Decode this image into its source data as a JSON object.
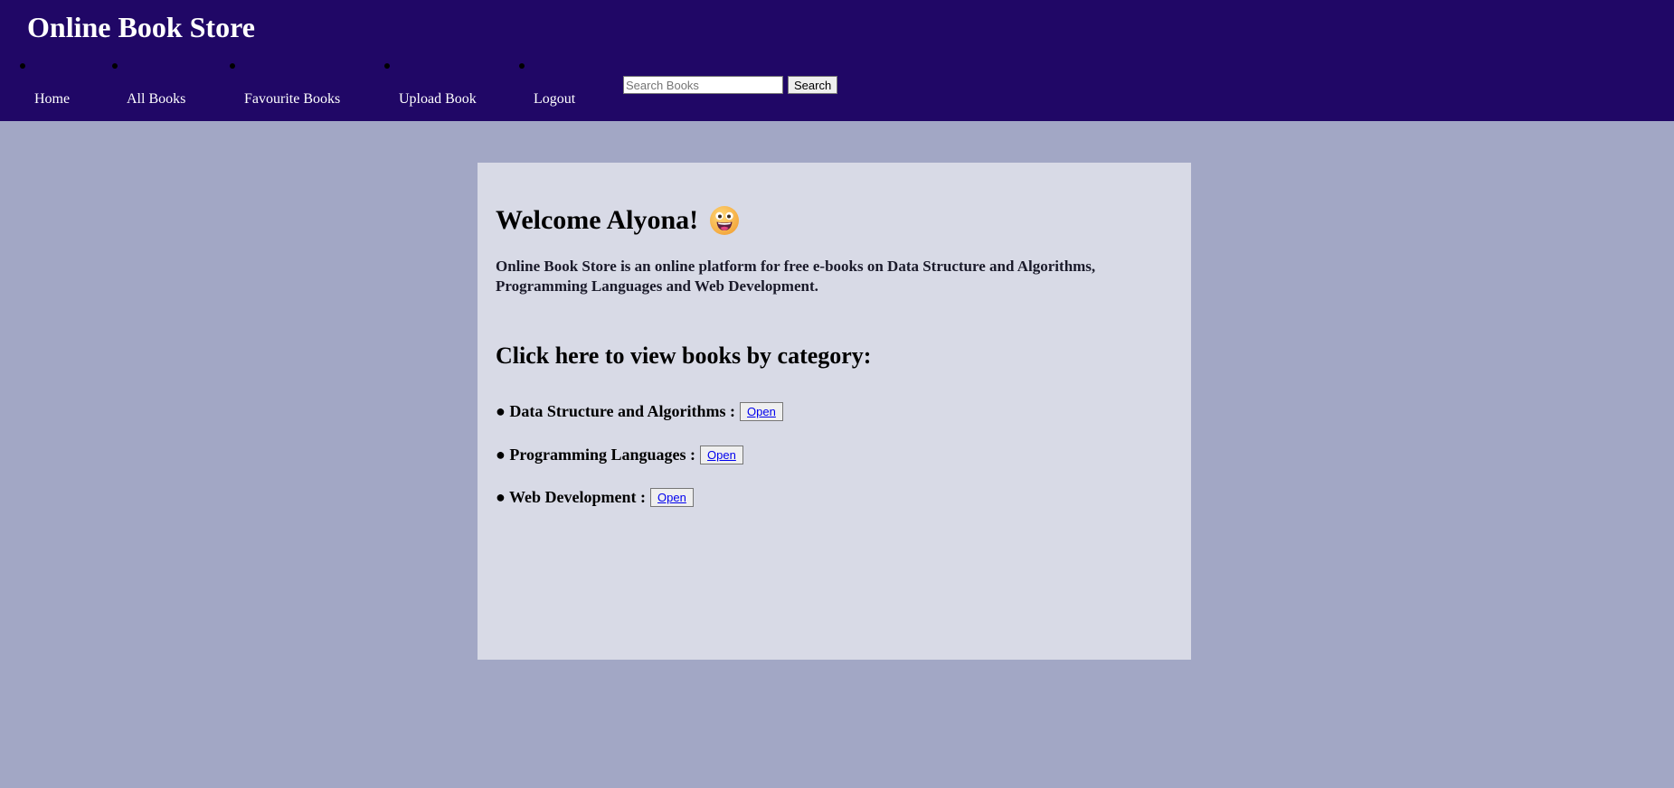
{
  "header": {
    "title": "Online Book Store",
    "nav": [
      {
        "label": "Home"
      },
      {
        "label": "All Books"
      },
      {
        "label": "Favourite Books"
      },
      {
        "label": "Upload Book"
      },
      {
        "label": "Logout"
      }
    ],
    "search": {
      "placeholder": "Search Books",
      "value": "",
      "button_label": "Search"
    }
  },
  "main": {
    "welcome": "Welcome Alyona!",
    "welcome_emoji": "grinning-face-emoji",
    "intro": "Online Book Store is an online platform for free e-books on Data Structure and Algorithms, Programming Languages and Web Development.",
    "category_heading": "Click here to view books by category:",
    "categories": [
      {
        "label": "● Data Structure and Algorithms :",
        "button_label": "Open"
      },
      {
        "label": "● Programming Languages :",
        "button_label": "Open"
      },
      {
        "label": "● Web Development :",
        "button_label": "Open"
      }
    ]
  },
  "colors": {
    "header_bg": "#200766",
    "page_bg": "#a2a7c5",
    "panel_bg": "#d8dae6",
    "link": "#0000ee"
  }
}
